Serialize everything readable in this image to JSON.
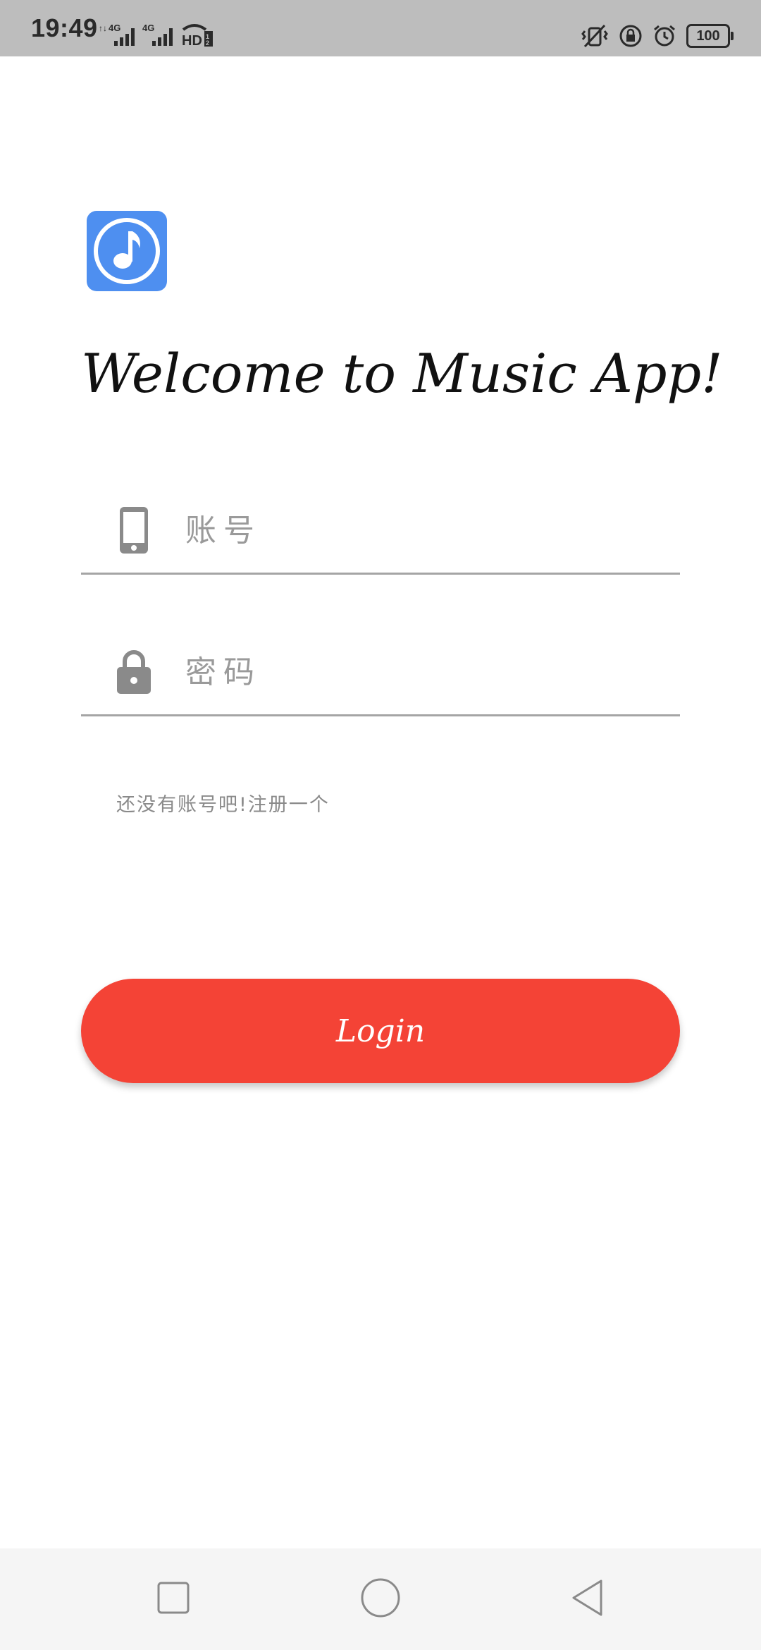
{
  "status_bar": {
    "time": "19:49",
    "network_1": "4G",
    "network_2": "4G",
    "hd_label": "HD",
    "battery": "100",
    "icons": [
      "signal-icon",
      "signal-icon",
      "hd-icon",
      "vibrate-icon",
      "rotation-lock-icon",
      "alarm-icon",
      "battery-icon"
    ]
  },
  "app": {
    "logo_icon": "music-note-icon",
    "logo_color": "#4e8ff0",
    "welcome": "Welcome to Music App!"
  },
  "form": {
    "account_placeholder": "账号",
    "account_icon": "phone-icon",
    "password_placeholder": "密码",
    "password_icon": "lock-icon",
    "register_link": "还没有账号吧!注册一个",
    "login_label": "Login",
    "login_color": "#f44336"
  },
  "nav_bar": {
    "icons": [
      "recents-square-icon",
      "home-circle-icon",
      "back-triangle-icon"
    ]
  }
}
